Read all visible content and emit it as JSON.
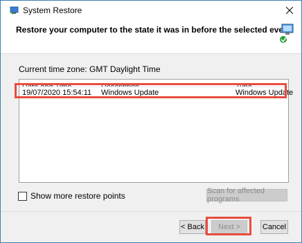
{
  "window": {
    "title": "System Restore"
  },
  "header": {
    "instruction": "Restore your computer to the state it was in before the selected event"
  },
  "timezone_label": "Current time zone: GMT Daylight Time",
  "restore_points": {
    "columns": [
      "Date and Time",
      "Description",
      "Type"
    ],
    "rows": [
      {
        "date_time": "19/07/2020 15:54:11",
        "description": "Windows Update",
        "type": "Windows Update"
      }
    ]
  },
  "show_more": {
    "label": "Show more restore points",
    "checked": false
  },
  "buttons": {
    "scan": "Scan for affected programs",
    "back": "< Back",
    "next": "Next >",
    "cancel": "Cancel"
  },
  "colors": {
    "highlight": "#e84c3d",
    "desktop": "#0a63b0"
  }
}
